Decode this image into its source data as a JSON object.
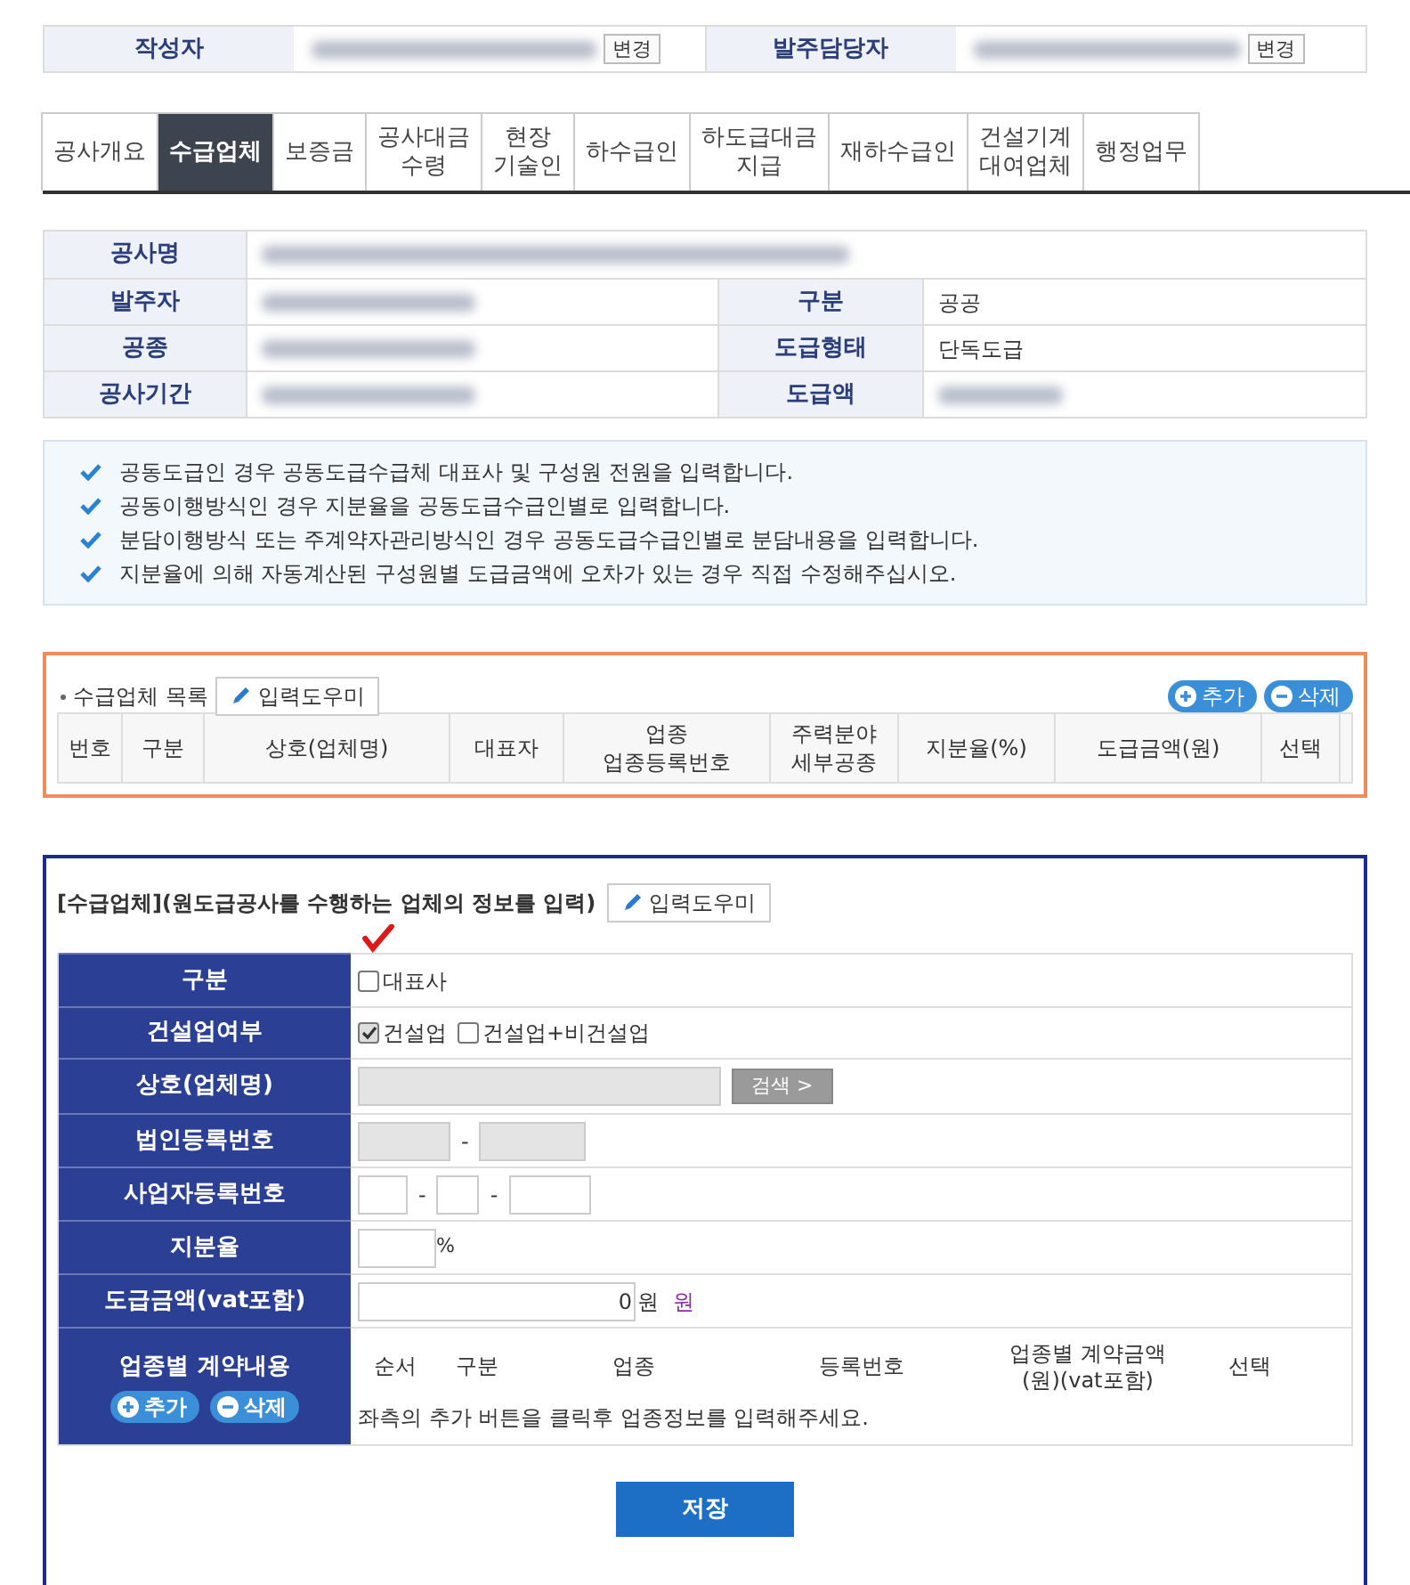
{
  "header": {
    "fields": [
      {
        "label": "작성자",
        "button": "변경"
      },
      {
        "label": "발주담당자",
        "button": "변경"
      }
    ]
  },
  "tabs": [
    {
      "label": "공사개요",
      "selected": false
    },
    {
      "label": "수급업체",
      "selected": true
    },
    {
      "label": "보증금",
      "selected": false
    },
    {
      "label": "공사대금\n수령",
      "selected": false
    },
    {
      "label": "현장\n기술인",
      "selected": false
    },
    {
      "label": "하수급인",
      "selected": false
    },
    {
      "label": "하도급대금\n지급",
      "selected": false
    },
    {
      "label": "재하수급인",
      "selected": false
    },
    {
      "label": "건설기계\n대여업체",
      "selected": false
    },
    {
      "label": "행정업무",
      "selected": false
    }
  ],
  "project_info": {
    "rows": [
      {
        "label": "공사명"
      },
      {
        "label": "발주자",
        "label2": "구분",
        "value2": "공공"
      },
      {
        "label": "공종",
        "label2": "도급형태",
        "value2": "단독도급"
      },
      {
        "label": "공사기간",
        "label2": "도급액"
      }
    ]
  },
  "notices": [
    "공동도급인 경우 공동도급수급체 대표사 및 구성원 전원을 입력합니다.",
    "공동이행방식인 경우 지분율을 공동도급수급인별로 입력합니다.",
    "분담이행방식 또는 주계약자관리방식인 경우 공동도급수급인별로 분담내용을 입력합니다.",
    "지분율에 의해 자동계산된 구성원별 도급금액에 오차가 있는 경우 직접 수정해주십시오."
  ],
  "contractor_list": {
    "title": "수급업체 목록",
    "help_button": "입력도우미",
    "add_button": "추가",
    "delete_button": "삭제",
    "columns": [
      "번호",
      "구분",
      "상호(업체명)",
      "대표자",
      "업종\n업종등록번호",
      "주력분야\n세부공종",
      "지분율(%)",
      "도급금액(원)",
      "선택"
    ]
  },
  "form": {
    "title": "[수급업체](원도급공사를 수행하는 업체의 정보를 입력)",
    "help_button": "입력도우미",
    "rows": [
      {
        "kind": "checks",
        "label": "구분",
        "options": [
          {
            "label": "대표사",
            "checked": false
          }
        ]
      },
      {
        "kind": "checks",
        "label": "건설업여부",
        "options": [
          {
            "label": "건설업",
            "checked": true
          },
          {
            "label": "건설업+비건설업",
            "checked": false
          }
        ]
      },
      {
        "kind": "search",
        "label": "상호(업체명)",
        "button": "검색 >"
      },
      {
        "kind": "split",
        "label": "법인등록번호",
        "separators": [
          "-"
        ],
        "disabled": true
      },
      {
        "kind": "split",
        "label": "사업자등록번호",
        "separators": [
          "-",
          "-"
        ],
        "disabled": false
      },
      {
        "kind": "percent",
        "label": "지분율",
        "unit": "%"
      },
      {
        "kind": "amount",
        "label": "도급금액(vat포함)",
        "value": "0",
        "unit": "원",
        "link": "원"
      },
      {
        "kind": "sub_table",
        "label": "업종별 계약내용",
        "add_button": "추가",
        "delete_button": "삭제",
        "columns": [
          "순서",
          "구분",
          "업종",
          "등록번호",
          "업종별 계약금액\n(원)(vat포함)",
          "선택"
        ],
        "empty_message": "좌측의 추가 버튼을 클릭후 업종정보를 입력해주세요."
      }
    ]
  },
  "save_button": "저장"
}
